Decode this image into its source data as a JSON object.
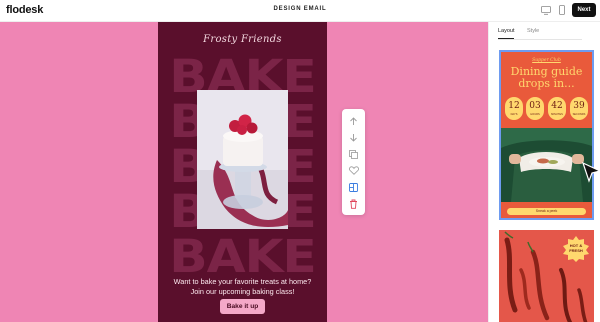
{
  "app": {
    "logo": "flodesk",
    "doc_title": "DESIGN EMAIL",
    "next_label": "Next"
  },
  "devices": [
    "desktop-icon",
    "mobile-icon"
  ],
  "email": {
    "script_title": "Frosty Friends",
    "bake_word": "BAKE",
    "cta_text": "Want to bake your favorite treats at home? Join our upcoming baking class!",
    "button_label": "Bake it up",
    "colors": {
      "background": "#5a0f2c",
      "canvas": "#ef85b4",
      "button": "#f4a8c8"
    }
  },
  "toolbar": {
    "tools": [
      "move-up-icon",
      "move-down-icon",
      "duplicate-icon",
      "heart-icon",
      "layout-icon",
      "delete-icon"
    ]
  },
  "panel": {
    "tabs": [
      {
        "label": "Layout",
        "active": true
      },
      {
        "label": "Style",
        "active": false
      }
    ],
    "template1": {
      "script_title": "Supper Club",
      "headline_line1": "Dining guide",
      "headline_line2": "drops in...",
      "countdown": [
        {
          "value": "12",
          "unit": "DAYS"
        },
        {
          "value": "03",
          "unit": "HOURS"
        },
        {
          "value": "42",
          "unit": "MINUTES"
        },
        {
          "value": "39",
          "unit": "SECONDS"
        }
      ],
      "button_label": "Sneak a peek"
    },
    "template2": {
      "badge_line1": "HOT &",
      "badge_line2": "FRESH"
    }
  }
}
